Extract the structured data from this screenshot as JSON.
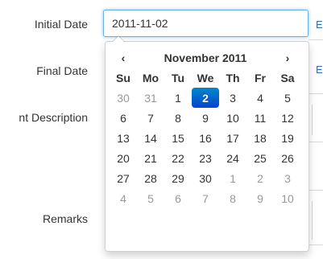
{
  "form": {
    "labels": {
      "initial_date": "Initial Date",
      "final_date": "Final Date",
      "description": "nt Description",
      "remarks": "Remarks"
    },
    "initial_date_value": "2011-11-02",
    "side_buttons": [
      "E",
      "E"
    ]
  },
  "datepicker": {
    "prev": "‹",
    "next": "›",
    "month_label": "November 2011",
    "weekdays": [
      "Su",
      "Mo",
      "Tu",
      "We",
      "Th",
      "Fr",
      "Sa"
    ],
    "weeks": [
      [
        "30",
        "31",
        "1",
        "2",
        "3",
        "4",
        "5"
      ],
      [
        "6",
        "7",
        "8",
        "9",
        "10",
        "11",
        "12"
      ],
      [
        "13",
        "14",
        "15",
        "16",
        "17",
        "18",
        "19"
      ],
      [
        "20",
        "21",
        "22",
        "23",
        "24",
        "25",
        "26"
      ],
      [
        "27",
        "28",
        "29",
        "30",
        "1",
        "2",
        "3"
      ],
      [
        "4",
        "5",
        "6",
        "7",
        "8",
        "9",
        "10"
      ]
    ],
    "selected_day": "2",
    "colors": {
      "active_top": "#0088cc",
      "active_bottom": "#0044cc",
      "muted": "#999999"
    }
  }
}
